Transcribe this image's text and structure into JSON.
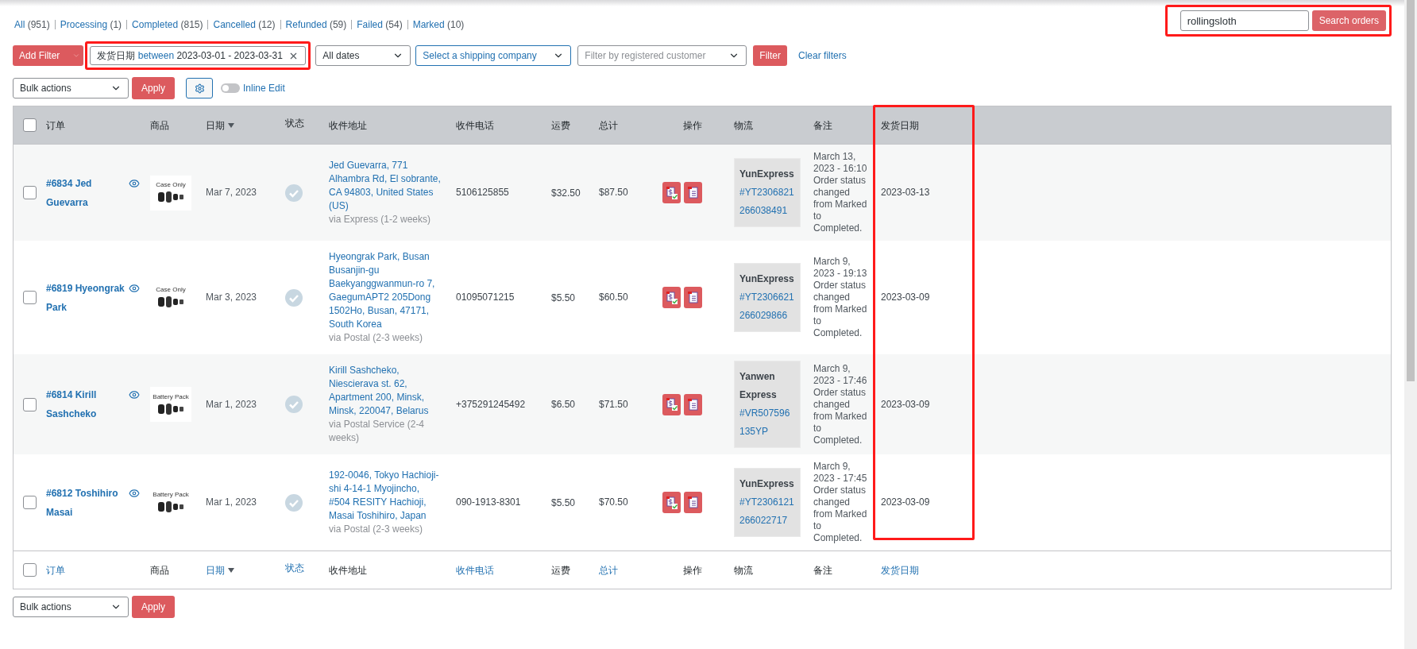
{
  "status_links": [
    {
      "label": "All",
      "count": "(951)",
      "selected": false
    },
    {
      "label": "Processing",
      "count": "(1)",
      "selected": false
    },
    {
      "label": "Completed",
      "count": "(815)",
      "selected": false
    },
    {
      "label": "Cancelled",
      "count": "(12)",
      "selected": false
    },
    {
      "label": "Refunded",
      "count": "(59)",
      "selected": false
    },
    {
      "label": "Failed",
      "count": "(54)",
      "selected": false
    },
    {
      "label": "Marked",
      "count": "(10)",
      "selected": false
    }
  ],
  "search": {
    "value": "rollingsloth",
    "button": "Search orders"
  },
  "filters": {
    "add_filter": "Add Filter",
    "active_filter": {
      "field": "发货日期",
      "operator": "between",
      "value": "2023-03-01 - 2023-03-31"
    },
    "dates": {
      "value": "All dates"
    },
    "shipping_company": {
      "value": "Select a shipping company"
    },
    "customer": {
      "placeholder": "Filter by registered customer"
    },
    "filter_button": "Filter",
    "clear_link": "Clear filters"
  },
  "bulk_top": {
    "value": "Bulk actions",
    "apply": "Apply"
  },
  "inline_edit": {
    "label": "Inline Edit",
    "on": false
  },
  "header": {
    "checked": false,
    "columns": [
      {
        "label": "订单",
        "sorted": false
      },
      {
        "label": "商品",
        "sorted": false
      },
      {
        "label": "日期",
        "sorted": true
      },
      {
        "label": "状态",
        "sorted": false
      },
      {
        "label": "收件地址",
        "sorted": false
      },
      {
        "label": "收件电话",
        "sorted": false
      },
      {
        "label": "运费",
        "sorted": false
      },
      {
        "label": "总计",
        "sorted": false
      },
      {
        "label": "操作",
        "sorted": false
      },
      {
        "label": "物流",
        "sorted": false
      },
      {
        "label": "备注",
        "sorted": false
      },
      {
        "label": "发货日期",
        "sorted": false
      }
    ]
  },
  "footer": {
    "checked": false,
    "columns": [
      {
        "label": "订单",
        "link": true,
        "sorted": false
      },
      {
        "label": "商品",
        "link": false,
        "sorted": false
      },
      {
        "label": "日期",
        "link": true,
        "sorted": true
      },
      {
        "label": "状态",
        "link": true,
        "sorted": false
      },
      {
        "label": "收件地址",
        "link": false,
        "sorted": false
      },
      {
        "label": "收件电话",
        "link": true,
        "sorted": false
      },
      {
        "label": "运费",
        "link": false,
        "sorted": false
      },
      {
        "label": "总计",
        "link": true,
        "sorted": false
      },
      {
        "label": "操作",
        "link": false,
        "sorted": false
      },
      {
        "label": "物流",
        "link": false,
        "sorted": false
      },
      {
        "label": "备注",
        "link": false,
        "sorted": false
      },
      {
        "label": "发货日期",
        "link": true,
        "sorted": false
      }
    ]
  },
  "rows": [
    {
      "checked": false,
      "order": "#6834 Jed Guevarra",
      "product_label": "Case Only",
      "date": "Mar 7, 2023",
      "address": "Jed Guevarra, 771 Alhambra Rd, El sobrante, CA 94803, United States (US)",
      "method": "via Express (1-2 weeks)",
      "phone": "5106125855",
      "shipping": "$32.50",
      "total": "$87.50",
      "carrier": "YunExpress",
      "tracking": "#YT2306821266038491",
      "note_date": "March 13, 2023 - 16:10",
      "note": "Order status changed from Marked to Completed.",
      "ship_date": "2023-03-13"
    },
    {
      "checked": false,
      "order": "#6819 Hyeongrak Park",
      "product_label": "Case Only",
      "date": "Mar 3, 2023",
      "address": "Hyeongrak Park, Busan Busanjin-gu Baekyanggwanmun-ro 7, GaegumAPT2 205Dong 1502Ho, Busan, 47171, South Korea",
      "method": "via Postal (2-3 weeks)",
      "phone": "01095071215",
      "shipping": "$5.50",
      "total": "$60.50",
      "carrier": "YunExpress",
      "tracking": "#YT2306621266029866",
      "note_date": "March 9, 2023 - 19:13",
      "note": "Order status changed from Marked to Completed.",
      "ship_date": "2023-03-09"
    },
    {
      "checked": false,
      "order": "#6814 Kirill Sashcheko",
      "product_label": "Battery Pack",
      "date": "Mar 1, 2023",
      "address": "Kirill Sashcheko, Niescierava st. 62, Apartment 200, Minsk, Minsk, 220047, Belarus",
      "method": "via Postal Service (2-4 weeks)",
      "phone": "+375291245492",
      "shipping": "$6.50",
      "total": "$71.50",
      "carrier": "Yanwen Express",
      "tracking": "#VR507596135YP",
      "note_date": "March 9, 2023 - 17:46",
      "note": "Order status changed from Marked to Completed.",
      "ship_date": "2023-03-09"
    },
    {
      "checked": false,
      "order": "#6812 Toshihiro Masai",
      "product_label": "Battery Pack",
      "date": "Mar 1, 2023",
      "address": "192-0046, Tokyo Hachioji-shi 4-14-1 Myojincho, #504 RESITY Hachioji, Masai Toshihiro, Japan",
      "method": "via Postal (2-3 weeks)",
      "phone": "090-1913-8301",
      "shipping": "$5.50",
      "total": "$70.50",
      "carrier": "YunExpress",
      "tracking": "#YT2306121266022717",
      "note_date": "March 9, 2023 - 17:45",
      "note": "Order status changed from Marked to Completed.",
      "ship_date": "2023-03-09"
    }
  ],
  "bulk_bottom": {
    "value": "Bulk actions",
    "apply": "Apply"
  }
}
